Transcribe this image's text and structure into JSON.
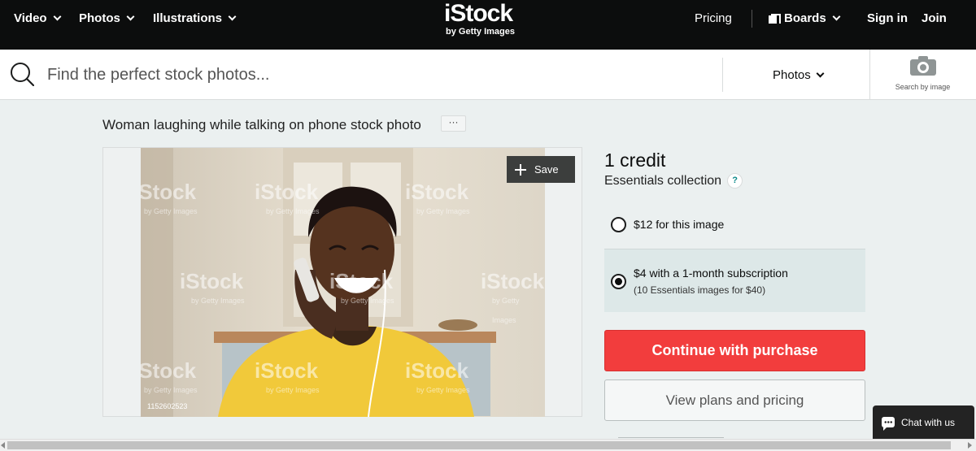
{
  "topnav": {
    "video_label": "Video",
    "photos_label": "Photos",
    "illustrations_label": "Illustrations",
    "logo_text": "iStock",
    "logo_subtext": "by Getty Images",
    "pricing_label": "Pricing",
    "boards_label": "Boards",
    "signin_label": "Sign in",
    "join_label": "Join"
  },
  "search": {
    "placeholder": "Find the perfect stock photos...",
    "media_type": "Photos",
    "search_by_image_label": "Search by image"
  },
  "asset": {
    "title": "Woman laughing while talking on phone stock photo",
    "more_label": "···",
    "save_label": "Save",
    "photo_id": "1152602523",
    "watermark_text": "iStock",
    "watermark_subtext": "by Getty Images"
  },
  "purchase": {
    "credit_label": "1 credit",
    "collection_label": "Essentials collection",
    "help_label": "?",
    "option_single_label": "$12 for this image",
    "option_subscription_label": "$4 with a 1-month subscription",
    "option_subscription_sub": "(10 Essentials images for $40)",
    "selected_option": "subscription",
    "continue_label": "Continue with purchase",
    "view_plans_label": "View plans and pricing"
  },
  "chat": {
    "label": "Chat with us"
  },
  "colors": {
    "nav_bg": "#0c0d0d",
    "page_bg": "#ebf0f0",
    "cta_red": "#f23d3d",
    "selected_option_bg": "#dde8e8",
    "accent_teal": "#0c8a8a"
  }
}
